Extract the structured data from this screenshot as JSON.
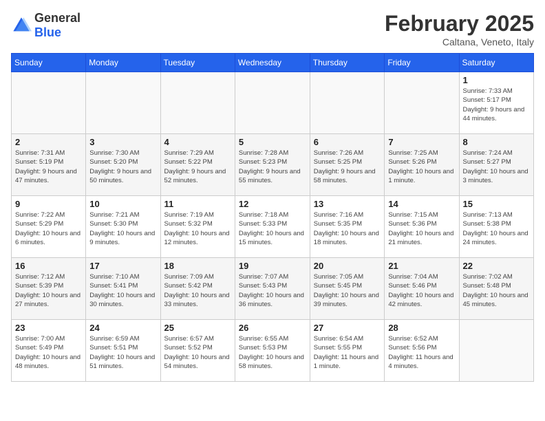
{
  "header": {
    "logo_general": "General",
    "logo_blue": "Blue",
    "title": "February 2025",
    "subtitle": "Caltana, Veneto, Italy"
  },
  "days_of_week": [
    "Sunday",
    "Monday",
    "Tuesday",
    "Wednesday",
    "Thursday",
    "Friday",
    "Saturday"
  ],
  "weeks": [
    [
      {
        "day": "",
        "info": ""
      },
      {
        "day": "",
        "info": ""
      },
      {
        "day": "",
        "info": ""
      },
      {
        "day": "",
        "info": ""
      },
      {
        "day": "",
        "info": ""
      },
      {
        "day": "",
        "info": ""
      },
      {
        "day": "1",
        "info": "Sunrise: 7:33 AM\nSunset: 5:17 PM\nDaylight: 9 hours and 44 minutes."
      }
    ],
    [
      {
        "day": "2",
        "info": "Sunrise: 7:31 AM\nSunset: 5:19 PM\nDaylight: 9 hours and 47 minutes."
      },
      {
        "day": "3",
        "info": "Sunrise: 7:30 AM\nSunset: 5:20 PM\nDaylight: 9 hours and 50 minutes."
      },
      {
        "day": "4",
        "info": "Sunrise: 7:29 AM\nSunset: 5:22 PM\nDaylight: 9 hours and 52 minutes."
      },
      {
        "day": "5",
        "info": "Sunrise: 7:28 AM\nSunset: 5:23 PM\nDaylight: 9 hours and 55 minutes."
      },
      {
        "day": "6",
        "info": "Sunrise: 7:26 AM\nSunset: 5:25 PM\nDaylight: 9 hours and 58 minutes."
      },
      {
        "day": "7",
        "info": "Sunrise: 7:25 AM\nSunset: 5:26 PM\nDaylight: 10 hours and 1 minute."
      },
      {
        "day": "8",
        "info": "Sunrise: 7:24 AM\nSunset: 5:27 PM\nDaylight: 10 hours and 3 minutes."
      }
    ],
    [
      {
        "day": "9",
        "info": "Sunrise: 7:22 AM\nSunset: 5:29 PM\nDaylight: 10 hours and 6 minutes."
      },
      {
        "day": "10",
        "info": "Sunrise: 7:21 AM\nSunset: 5:30 PM\nDaylight: 10 hours and 9 minutes."
      },
      {
        "day": "11",
        "info": "Sunrise: 7:19 AM\nSunset: 5:32 PM\nDaylight: 10 hours and 12 minutes."
      },
      {
        "day": "12",
        "info": "Sunrise: 7:18 AM\nSunset: 5:33 PM\nDaylight: 10 hours and 15 minutes."
      },
      {
        "day": "13",
        "info": "Sunrise: 7:16 AM\nSunset: 5:35 PM\nDaylight: 10 hours and 18 minutes."
      },
      {
        "day": "14",
        "info": "Sunrise: 7:15 AM\nSunset: 5:36 PM\nDaylight: 10 hours and 21 minutes."
      },
      {
        "day": "15",
        "info": "Sunrise: 7:13 AM\nSunset: 5:38 PM\nDaylight: 10 hours and 24 minutes."
      }
    ],
    [
      {
        "day": "16",
        "info": "Sunrise: 7:12 AM\nSunset: 5:39 PM\nDaylight: 10 hours and 27 minutes."
      },
      {
        "day": "17",
        "info": "Sunrise: 7:10 AM\nSunset: 5:41 PM\nDaylight: 10 hours and 30 minutes."
      },
      {
        "day": "18",
        "info": "Sunrise: 7:09 AM\nSunset: 5:42 PM\nDaylight: 10 hours and 33 minutes."
      },
      {
        "day": "19",
        "info": "Sunrise: 7:07 AM\nSunset: 5:43 PM\nDaylight: 10 hours and 36 minutes."
      },
      {
        "day": "20",
        "info": "Sunrise: 7:05 AM\nSunset: 5:45 PM\nDaylight: 10 hours and 39 minutes."
      },
      {
        "day": "21",
        "info": "Sunrise: 7:04 AM\nSunset: 5:46 PM\nDaylight: 10 hours and 42 minutes."
      },
      {
        "day": "22",
        "info": "Sunrise: 7:02 AM\nSunset: 5:48 PM\nDaylight: 10 hours and 45 minutes."
      }
    ],
    [
      {
        "day": "23",
        "info": "Sunrise: 7:00 AM\nSunset: 5:49 PM\nDaylight: 10 hours and 48 minutes."
      },
      {
        "day": "24",
        "info": "Sunrise: 6:59 AM\nSunset: 5:51 PM\nDaylight: 10 hours and 51 minutes."
      },
      {
        "day": "25",
        "info": "Sunrise: 6:57 AM\nSunset: 5:52 PM\nDaylight: 10 hours and 54 minutes."
      },
      {
        "day": "26",
        "info": "Sunrise: 6:55 AM\nSunset: 5:53 PM\nDaylight: 10 hours and 58 minutes."
      },
      {
        "day": "27",
        "info": "Sunrise: 6:54 AM\nSunset: 5:55 PM\nDaylight: 11 hours and 1 minute."
      },
      {
        "day": "28",
        "info": "Sunrise: 6:52 AM\nSunset: 5:56 PM\nDaylight: 11 hours and 4 minutes."
      },
      {
        "day": "",
        "info": ""
      }
    ]
  ]
}
